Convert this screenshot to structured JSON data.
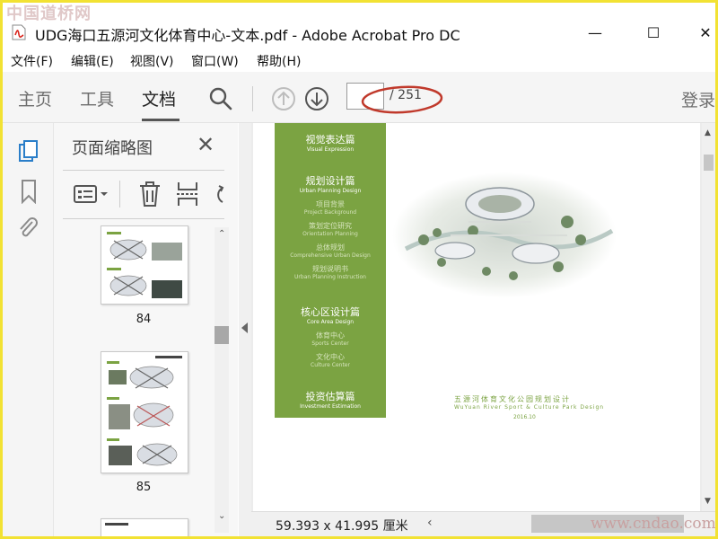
{
  "watermark": {
    "top": "中国道桥网",
    "bottom": "www.cndao.com"
  },
  "window": {
    "title": "UDG海口五源河文化体育中心-文本.pdf - Adobe Acrobat Pro DC"
  },
  "menu": [
    "文件(F)",
    "编辑(E)",
    "视图(V)",
    "窗口(W)",
    "帮助(H)"
  ],
  "toolbar": {
    "tabs": [
      "主页",
      "工具",
      "文档"
    ],
    "active_tab": "文档",
    "page_current": "",
    "page_total": "/ 251",
    "login": "登录"
  },
  "thumbnail_panel": {
    "title": "页面缩略图",
    "pages": [
      "84",
      "85"
    ]
  },
  "document": {
    "sections": [
      {
        "title": "视觉表达篇",
        "sub": "Visual Expression",
        "items": []
      },
      {
        "title": "规划设计篇",
        "sub": "Urban Planning Design",
        "items": [
          {
            "cn": "项目背景",
            "en": "Project Background"
          },
          {
            "cn": "策划定位研究",
            "en": "Orientation Planning"
          },
          {
            "cn": "总体规划",
            "en": "Comprehensive Urban Design"
          },
          {
            "cn": "规划说明书",
            "en": "Urban Planning Instruction"
          }
        ]
      },
      {
        "title": "核心区设计篇",
        "sub": "Core Area Design",
        "items": [
          {
            "cn": "体育中心",
            "en": "Sports Center"
          },
          {
            "cn": "文化中心",
            "en": "Culture Center"
          }
        ]
      },
      {
        "title": "投资估算篇",
        "sub": "Investment Estimation",
        "items": []
      }
    ],
    "project_title": "五源河体育文化公园规划设计",
    "project_subtitle": "WuYuan River Sport & Culture Park Design",
    "date": "2016.10"
  },
  "status": {
    "page_size": "59.393 x 41.995 厘米"
  },
  "colors": {
    "accent_green": "#7ba342",
    "annotation_red": "#c0392b"
  }
}
